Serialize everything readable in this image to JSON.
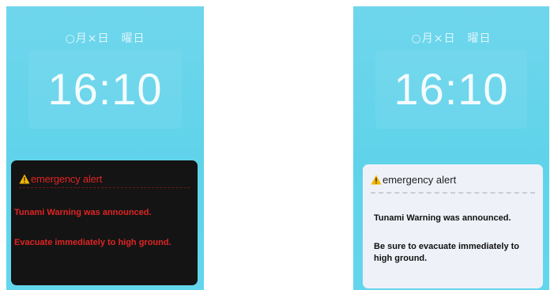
{
  "left_screen": {
    "date": "○月×日　曜日",
    "time": "16:10",
    "alert": {
      "icon": "warning-triangle-icon",
      "title": "emergency alert",
      "line1": "Tunami Warning was announced.",
      "line2": "Evacuate immediately to high ground.",
      "background": "#141414",
      "text_color": "#e02424"
    }
  },
  "right_screen": {
    "date": "○月×日　曜日",
    "time": "16:10",
    "alert": {
      "icon": "warning-triangle-icon",
      "title": "emergency alert",
      "line1": "Tunami Warning was announced.",
      "line2": "Be sure to evacuate immediately to high ground.",
      "background": "#eef1f8",
      "text_color": "#111111"
    }
  },
  "colors": {
    "lockscreen_bg": "#63d6ee",
    "warning_yellow": "#f2b705"
  }
}
